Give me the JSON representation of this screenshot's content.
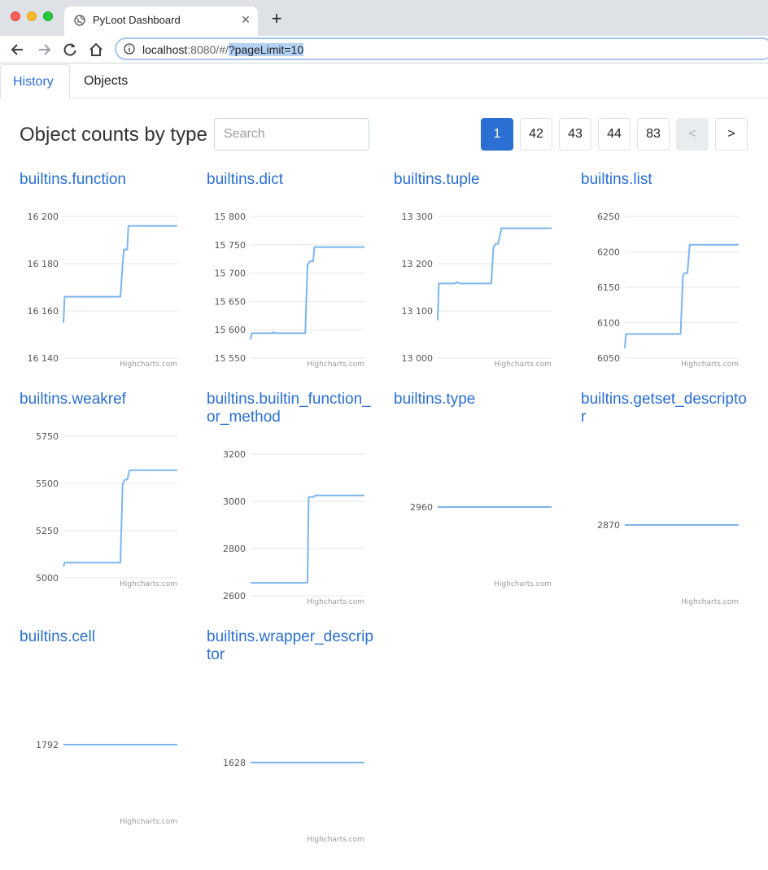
{
  "browser": {
    "tab_title": "PyLoot Dashboard",
    "url_host": "localhost",
    "url_rest": ":8080/#/",
    "url_query": "?pageLimit=10"
  },
  "nav": {
    "tabs": [
      {
        "label": "History"
      },
      {
        "label": "Objects"
      }
    ]
  },
  "header": {
    "title": "Object counts by type",
    "search_placeholder": "Search"
  },
  "pagination": {
    "pages": [
      "1",
      "42",
      "43",
      "44",
      "83"
    ],
    "current": "1",
    "prev": "<",
    "next": ">"
  },
  "colors": {
    "accent": "#2a6fd1",
    "series": "#7cb5ec"
  },
  "chart_data": [
    {
      "type": "line",
      "title": "builtins.function",
      "ylim": [
        16140,
        16200
      ],
      "yticks": [
        "16 200",
        "16 180",
        "16 160",
        "16 140"
      ],
      "ytick_values": [
        16200,
        16180,
        16160,
        16140
      ],
      "credit": "Highcharts.com",
      "points": [
        [
          0,
          16155
        ],
        [
          0.01,
          16166
        ],
        [
          0.04,
          16166
        ],
        [
          0.5,
          16166
        ],
        [
          0.52,
          16180
        ],
        [
          0.53,
          16186
        ],
        [
          0.56,
          16186
        ],
        [
          0.57,
          16196
        ],
        [
          1,
          16196
        ]
      ]
    },
    {
      "type": "line",
      "title": "builtins.dict",
      "ylim": [
        15550,
        15800
      ],
      "yticks": [
        "15 800",
        "15 750",
        "15 700",
        "15 650",
        "15 600",
        "15 550"
      ],
      "ytick_values": [
        15800,
        15750,
        15700,
        15650,
        15600,
        15550
      ],
      "credit": "Highcharts.com",
      "points": [
        [
          0,
          15583
        ],
        [
          0.01,
          15594
        ],
        [
          0.2,
          15594
        ],
        [
          0.2,
          15596
        ],
        [
          0.22,
          15594
        ],
        [
          0.48,
          15594
        ],
        [
          0.5,
          15715
        ],
        [
          0.52,
          15721
        ],
        [
          0.55,
          15721
        ],
        [
          0.56,
          15746
        ],
        [
          1,
          15746
        ]
      ]
    },
    {
      "type": "line",
      "title": "builtins.tuple",
      "ylim": [
        13000,
        13300
      ],
      "yticks": [
        "13 300",
        "13 200",
        "13 100",
        "13 000"
      ],
      "ytick_values": [
        13300,
        13200,
        13100,
        13000
      ],
      "credit": "Highcharts.com",
      "points": [
        [
          0,
          13080
        ],
        [
          0.01,
          13158
        ],
        [
          0.15,
          13158
        ],
        [
          0.17,
          13161
        ],
        [
          0.19,
          13158
        ],
        [
          0.47,
          13158
        ],
        [
          0.49,
          13235
        ],
        [
          0.51,
          13242
        ],
        [
          0.53,
          13242
        ],
        [
          0.56,
          13275
        ],
        [
          1,
          13275
        ]
      ]
    },
    {
      "type": "line",
      "title": "builtins.list",
      "ylim": [
        6050,
        6250
      ],
      "yticks": [
        "6250",
        "6200",
        "6150",
        "6100",
        "6050"
      ],
      "ytick_values": [
        6250,
        6200,
        6150,
        6100,
        6050
      ],
      "credit": "Highcharts.com",
      "points": [
        [
          0,
          6064
        ],
        [
          0.01,
          6084
        ],
        [
          0.04,
          6084
        ],
        [
          0.49,
          6084
        ],
        [
          0.51,
          6165
        ],
        [
          0.52,
          6170
        ],
        [
          0.55,
          6170
        ],
        [
          0.57,
          6210
        ],
        [
          1,
          6210
        ]
      ]
    },
    {
      "type": "line",
      "title": "builtins.weakref",
      "ylim": [
        5000,
        5750
      ],
      "yticks": [
        "5750",
        "5500",
        "5250",
        "5000"
      ],
      "ytick_values": [
        5750,
        5500,
        5250,
        5000
      ],
      "credit": "Highcharts.com",
      "points": [
        [
          0,
          5060
        ],
        [
          0.01,
          5080
        ],
        [
          0.5,
          5080
        ],
        [
          0.52,
          5500
        ],
        [
          0.54,
          5520
        ],
        [
          0.56,
          5520
        ],
        [
          0.58,
          5570
        ],
        [
          1,
          5570
        ]
      ]
    },
    {
      "type": "line",
      "title": "builtins.builtin_function_or_method",
      "ylim": [
        2600,
        3200
      ],
      "yticks": [
        "3200",
        "3000",
        "2800",
        "2600"
      ],
      "ytick_values": [
        3200,
        3000,
        2800,
        2600
      ],
      "credit": "Highcharts.com",
      "points": [
        [
          0,
          2655
        ],
        [
          0.5,
          2655
        ],
        [
          0.51,
          3018
        ],
        [
          0.55,
          3018
        ],
        [
          0.57,
          3025
        ],
        [
          1,
          3025
        ]
      ]
    },
    {
      "type": "line",
      "title": "builtins.type",
      "ylim": [
        2900,
        3020
      ],
      "yticks": [
        "2960"
      ],
      "ytick_values": [
        2960
      ],
      "credit": "Highcharts.com",
      "points": [
        [
          0,
          2960
        ],
        [
          1,
          2960
        ]
      ]
    },
    {
      "type": "line",
      "title": "builtins.getset_descriptor",
      "ylim": [
        2810,
        2930
      ],
      "yticks": [
        "2870"
      ],
      "ytick_values": [
        2870
      ],
      "credit": "Highcharts.com",
      "points": [
        [
          0,
          2870
        ],
        [
          1,
          2870
        ]
      ]
    },
    {
      "type": "line",
      "title": "builtins.cell",
      "ylim": [
        1732,
        1852
      ],
      "yticks": [
        "1792"
      ],
      "ytick_values": [
        1792
      ],
      "credit": "Highcharts.com",
      "points": [
        [
          0,
          1792
        ],
        [
          1,
          1792
        ]
      ]
    },
    {
      "type": "line",
      "title": "builtins.wrapper_descriptor",
      "ylim": [
        1568,
        1688
      ],
      "yticks": [
        "1628"
      ],
      "ytick_values": [
        1628
      ],
      "credit": "Highcharts.com",
      "points": [
        [
          0,
          1628
        ],
        [
          1,
          1628
        ]
      ]
    }
  ]
}
